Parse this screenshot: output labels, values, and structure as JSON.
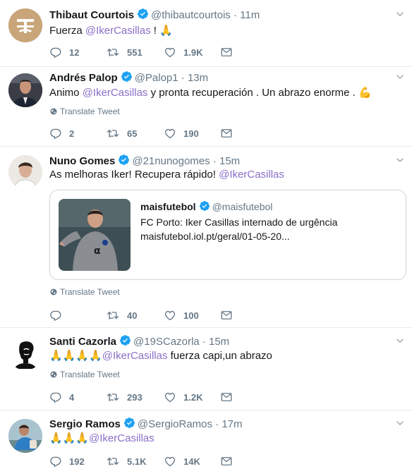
{
  "colors": {
    "mention": "#8a6fc7",
    "verified": "#1da1f2",
    "secondary": "#657786",
    "divider": "#e6ecf0"
  },
  "tweets": [
    {
      "name": "Thibaut Courtois",
      "handle": "@thibautcourtois",
      "dot": "·",
      "time": "11m",
      "text_before": "Fuerza ",
      "mention": "@IkerCasillas",
      "text_after": " ! ",
      "emoji": "🙏",
      "translate": "",
      "replies": "12",
      "retweets": "551",
      "likes": "1.9K"
    },
    {
      "name": "Andrés Palop",
      "handle": "@Palop1",
      "dot": "·",
      "time": "13m",
      "text_before": "Animo ",
      "mention": "@IkerCasillas",
      "text_after": " y pronta recuperación . Un abrazo enorme . ",
      "emoji": "💪",
      "translate": "Translate Tweet",
      "replies": "2",
      "retweets": "65",
      "likes": "190"
    },
    {
      "name": "Nuno Gomes",
      "handle": "@21nunogomes",
      "dot": "·",
      "time": "15m",
      "text_before": "As melhoras Iker! Recupera rápido! ",
      "mention": "@IkerCasillas",
      "text_after": "",
      "emoji": "",
      "quote": {
        "name": "maisfutebol",
        "handle": "@maisfutebol",
        "line1": "FC Porto: Iker Casillas internado de urgência",
        "line2": "maisfutebol.iol.pt/geral/01-05-20..."
      },
      "translate": "Translate Tweet",
      "replies": "",
      "retweets": "40",
      "likes": "100"
    },
    {
      "name": "Santi Cazorla",
      "handle": "@19SCazorla",
      "dot": "·",
      "time": "15m",
      "emoji_before": "🙏🙏🙏🙏",
      "mention": "@IkerCasillas",
      "text_after": " fuerza capi,un abrazo",
      "translate": "Translate Tweet",
      "replies": "4",
      "retweets": "293",
      "likes": "1.2K"
    },
    {
      "name": "Sergio Ramos",
      "handle": "@SergioRamos",
      "dot": "·",
      "time": "17m",
      "emoji_before": "🙏🙏🙏",
      "mention": "@IkerCasillas",
      "text_after": "",
      "translate": "",
      "replies": "192",
      "retweets": "5.1K",
      "likes": "14K"
    }
  ]
}
